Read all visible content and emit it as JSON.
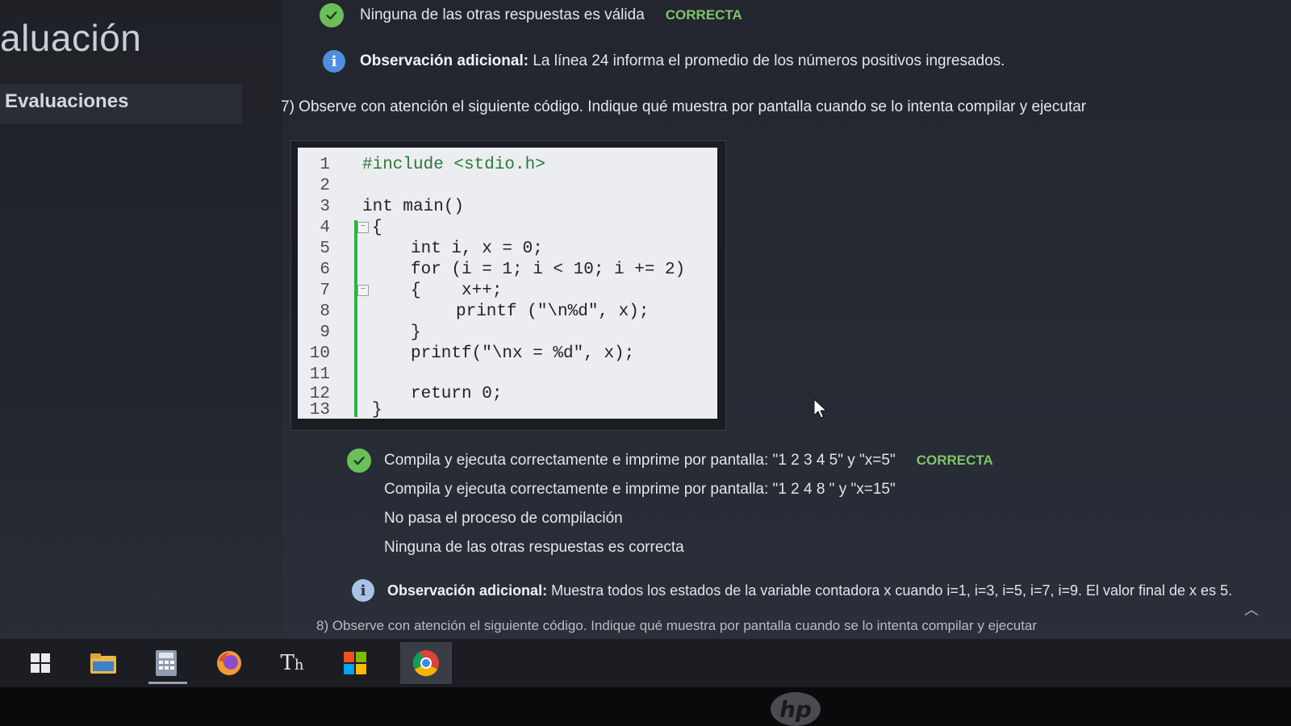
{
  "sidebar": {
    "title": "aluación",
    "items": [
      {
        "label": "Evaluaciones"
      }
    ]
  },
  "previous_question": {
    "selected_answer": "Ninguna de las otras respuestas es válida",
    "status": "CORRECTA",
    "observation": {
      "label": "Observación adicional:",
      "text": "La línea 24 informa el promedio de los números positivos ingresados."
    }
  },
  "question7": {
    "text": "7) Observe con atención el siguiente código. Indique qué muestra por pantalla cuando se lo intenta compilar y ejecutar",
    "code": {
      "line_numbers": [
        "1",
        "2",
        "3",
        "4",
        "5",
        "6",
        "7",
        "8",
        "9",
        "10",
        "11",
        "12",
        "13"
      ],
      "lines": [
        "#include <stdio.h>",
        "",
        "int main()",
        "{",
        "int i, x = 0;",
        "for (i = 1; i < 10; i += 2)",
        "{    x++;",
        "printf (\"\\n%d\", x);",
        "}",
        "printf(\"\\nx = %d\", x);",
        "",
        "return 0;",
        "}"
      ]
    },
    "options": [
      {
        "text": "Compila y ejecuta correctamente e imprime por pantalla: \"1 2 3 4 5\" y \"x=5\"",
        "status": "CORRECTA"
      },
      {
        "text": "Compila y ejecuta correctamente e imprime por pantalla: \"1 2 4 8 \" y \"x=15\""
      },
      {
        "text": "No pasa el proceso de compilación"
      },
      {
        "text": "Ninguna de las otras respuestas es correcta"
      }
    ],
    "observation": {
      "label": "Observación adicional:",
      "text": "Muestra todos los estados de la variable contadora x cuando i=1, i=3, i=5, i=7, i=9. El valor final de x es 5."
    }
  },
  "question8_partial": "8) Observe con atención el siguiente código. Indique qué muestra por pantalla cuando se lo intenta compilar y ejecutar",
  "taskbar": {
    "icons": [
      "windows-start-icon",
      "file-explorer-icon",
      "calculator-icon",
      "firefox-icon",
      "typora-icon",
      "microsoft-store-icon",
      "chrome-icon"
    ]
  },
  "monitor_brand": "hp",
  "colors": {
    "correct": "#7fc46a",
    "check": "#6bbf59",
    "info": "#4f8fe0",
    "highlight_bar": "#32b14a"
  }
}
